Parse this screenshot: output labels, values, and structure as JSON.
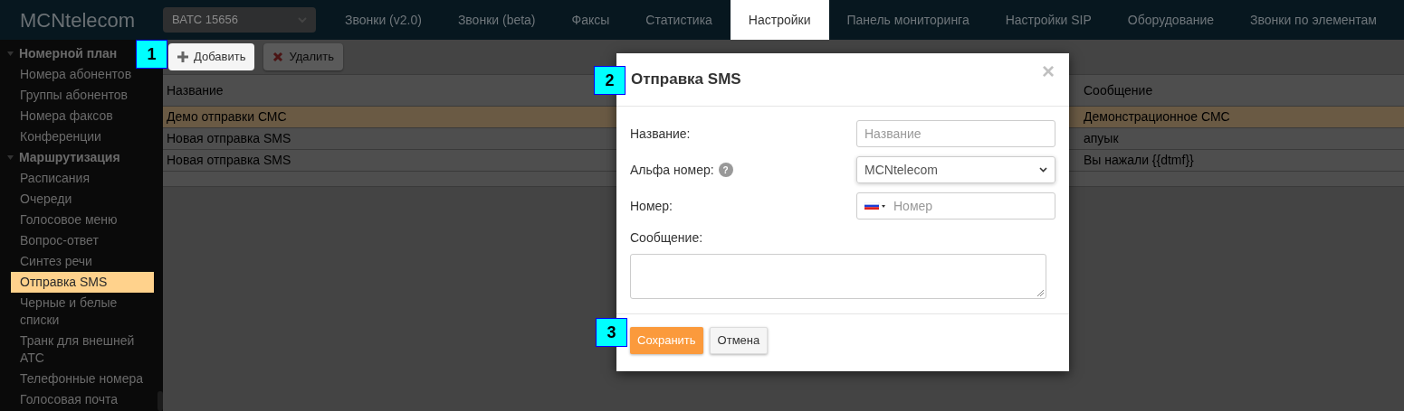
{
  "header": {
    "logo": "MCNtelecom",
    "account_select": "ВАТС 15656",
    "tabs": [
      {
        "label": "Звонки (v2.0)",
        "selected": false
      },
      {
        "label": "Звонки (beta)",
        "selected": false
      },
      {
        "label": "Факсы",
        "selected": false
      },
      {
        "label": "Статистика",
        "selected": false
      },
      {
        "label": "Настройки",
        "selected": true
      },
      {
        "label": "Панель мониторинга",
        "selected": false
      },
      {
        "label": "Настройки SIP",
        "selected": false
      },
      {
        "label": "Оборудование",
        "selected": false
      },
      {
        "label": "Звонки по элементам",
        "selected": false
      }
    ]
  },
  "sidebar": {
    "groups": [
      {
        "label": "Номерной план",
        "expanded": true,
        "children": [
          {
            "label": "Номера абонентов",
            "selected": false
          },
          {
            "label": "Группы абонентов",
            "selected": false
          },
          {
            "label": "Номера факсов",
            "selected": false
          },
          {
            "label": "Конференции",
            "selected": false
          }
        ]
      },
      {
        "label": "Маршрутизация",
        "expanded": true,
        "children": [
          {
            "label": "Расписания",
            "selected": false
          },
          {
            "label": "Очереди",
            "selected": false
          },
          {
            "label": "Голосовое меню",
            "selected": false
          },
          {
            "label": "Вопрос-ответ",
            "selected": false
          },
          {
            "label": "Синтез речи",
            "selected": false
          },
          {
            "label": "Отправка SMS",
            "selected": true
          },
          {
            "label": "Черные и белые списки",
            "selected": false
          },
          {
            "label": "Транк для внешней АТС",
            "selected": false
          },
          {
            "label": "Телефонные номера",
            "selected": false
          },
          {
            "label": "Голосовая почта",
            "selected": false
          }
        ]
      }
    ]
  },
  "toolbar": {
    "buttons": [
      {
        "kind": "add",
        "label": "Добавить",
        "highlighted": true
      },
      {
        "kind": "delete",
        "label": "Удалить",
        "highlighted": false
      }
    ]
  },
  "table": {
    "columns": [
      "Название",
      "Сообщение"
    ],
    "rows": [
      {
        "cells": [
          "Демо отправки СМС",
          "Демонстрационное СМС"
        ],
        "selected": true
      },
      {
        "cells": [
          "Новая отправка SMS",
          "апуык"
        ],
        "selected": false
      },
      {
        "cells": [
          "Новая отправка SMS",
          "Вы нажали {{dtmf}}"
        ],
        "selected": false
      }
    ]
  },
  "dialog": {
    "title": "Отправка SMS",
    "close": "×",
    "fields": [
      {
        "kind": "text",
        "label": "Название:",
        "placeholder": "Название"
      },
      {
        "kind": "select",
        "label": "Альфа номер:",
        "help": "?",
        "value": "MCNtelecom"
      },
      {
        "kind": "phone",
        "label": "Номер:",
        "placeholder": "Номер"
      },
      {
        "kind": "textarea",
        "label": "Сообщение:"
      }
    ],
    "buttons": [
      {
        "kind": "primary",
        "label": "Сохранить"
      },
      {
        "kind": "default",
        "label": "Отмена"
      }
    ]
  },
  "callouts": [
    "1",
    "2",
    "3"
  ]
}
